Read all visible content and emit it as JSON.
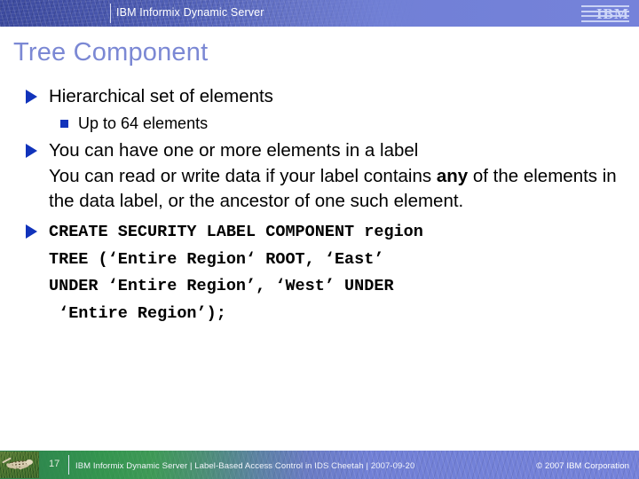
{
  "header": {
    "brand": "IBM Informix Dynamic Server",
    "logo_text": "IBM",
    "bg_start_color": "#3c4a9e",
    "bg_end_color": "#7582da"
  },
  "slide": {
    "title": "Tree Component",
    "title_color": "#7b88d4",
    "bullet_color": "#1133bb",
    "bullets": [
      {
        "level": 1,
        "text": "Hierarchical set of elements"
      },
      {
        "level": 2,
        "text": "Up to 64 elements"
      },
      {
        "level": 1,
        "text": "You can have one or more elements in a label"
      }
    ],
    "paragraph": {
      "lead": "You can read or write data if your label contains ",
      "emphasis": "any",
      "rest": " of the elements in the data label, or the ancestor of one such element."
    },
    "code": {
      "lines": [
        "CREATE SECURITY LABEL COMPONENT region",
        "TREE (‘Entire Region‘ ROOT, ‘East’",
        "UNDER ‘Entire Region’, ‘West’ UNDER",
        " ‘Entire Region’);"
      ]
    }
  },
  "footer": {
    "page_number": "17",
    "text": "IBM Informix Dynamic Server |  Label-Based Access Control in IDS Cheetah | 2007-09-20",
    "copyright": "© 2007 IBM Corporation",
    "bg_start_color": "#2f7f4a",
    "bg_end_color": "#7582da"
  }
}
